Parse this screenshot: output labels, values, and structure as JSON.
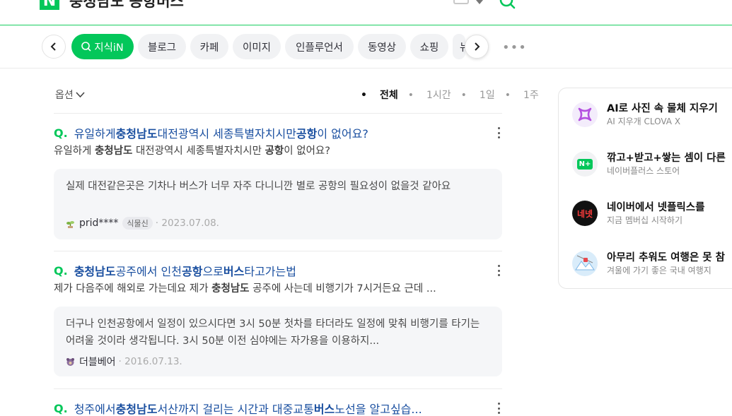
{
  "header": {
    "logo_letter": "N",
    "query": "충청남도 공항버스"
  },
  "tabs": [
    {
      "label": "지식iN",
      "active": true
    },
    {
      "label": "블로그"
    },
    {
      "label": "카페"
    },
    {
      "label": "이미지"
    },
    {
      "label": "인플루언서"
    },
    {
      "label": "동영상"
    },
    {
      "label": "쇼핑"
    },
    {
      "label": "뉴"
    }
  ],
  "options": {
    "label": "옵션",
    "sort": [
      "전체",
      "1시간",
      "1일",
      "1주"
    ],
    "sort_active": "전체"
  },
  "results": [
    {
      "q": "Q.",
      "title": [
        "유일하게 ",
        "충청남도",
        " 대전광역시 세종특별자치시만 ",
        "공항",
        "이 없어요?"
      ],
      "desc": [
        "유일하게 ",
        "충청남도",
        " 대전광역시 세종특별자치시만 ",
        "공항",
        "이 없어요?"
      ],
      "answer": "실제 대전같은곳은 기차나 버스가 너무 자주 다니니깐 별로 공항의 필요성이 없을것 같아요",
      "author": "prid****",
      "badge": "식물신",
      "date": "2023.07.08."
    },
    {
      "q": "Q.",
      "title": [
        "충청남도",
        " 공주에서 인천",
        "공항",
        "으로 ",
        "버스",
        "타고가는법"
      ],
      "desc": [
        "제가 다음주에 해외로 가는데요 제가 ",
        "충청남도",
        " 공주에 사는데 비행기가 7시거든요 근데 ..."
      ],
      "answer": "더구나 인천공항에서 일정이 있으시다면 3시 50분 첫차를 타더라도 일정에 맞춰 비행기를 타기는 어려울 것이라 생각됩니다. 3시 50분 이전 심야에는 자가용을 이용하지...",
      "author": "더블베어",
      "date": "2016.07.13."
    },
    {
      "q": "Q.",
      "title": [
        "청주에서 ",
        "충청남도",
        " 서산까지 걸리는 시간과 대중교통 ",
        "버스",
        "노선을 알고싶습..."
      ]
    }
  ],
  "side": [
    {
      "title": "AI로 사진 속 물체 지우기",
      "sub": "AI 지우개 CLOVA X",
      "icon": "clova-x-icon"
    },
    {
      "title": "깎고+받고+쌓는 셈이 다른",
      "sub": "네이버플러스 스토어",
      "icon": "naver-plus-icon",
      "icon_text": "N+"
    },
    {
      "title": "네이버에서 넷플릭스를",
      "sub": "지금 멤버십 시작하기",
      "icon": "netflix-icon",
      "icon_text": "네넷"
    },
    {
      "title": "아무리 추워도 여행은 못 참",
      "sub": "겨울에 가기 좋은 국내 여행지",
      "icon": "travel-icon"
    }
  ],
  "colors": {
    "brand_green": "#03c75a",
    "link_blue": "#1a4fa0"
  }
}
